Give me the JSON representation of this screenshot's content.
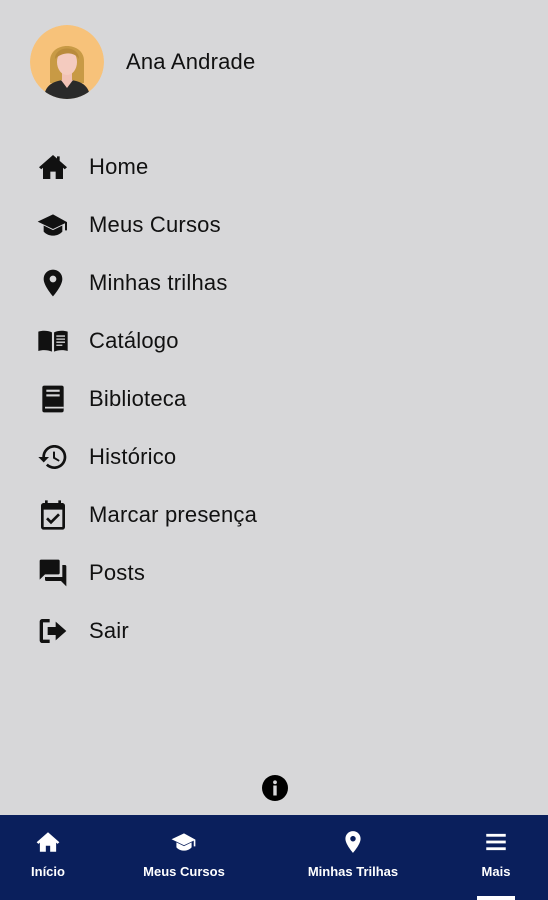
{
  "profile": {
    "name": "Ana Andrade",
    "avatar_icon": "user-avatar-icon"
  },
  "menu": {
    "items": [
      {
        "label": "Home",
        "icon": "home-icon"
      },
      {
        "label": "Meus Cursos",
        "icon": "graduation-cap-icon"
      },
      {
        "label": "Minhas trilhas",
        "icon": "map-pin-icon"
      },
      {
        "label": "Catálogo",
        "icon": "open-book-icon"
      },
      {
        "label": "Biblioteca",
        "icon": "book-icon"
      },
      {
        "label": "Histórico",
        "icon": "history-icon"
      },
      {
        "label": "Marcar presença",
        "icon": "calendar-check-icon"
      },
      {
        "label": "Posts",
        "icon": "forum-icon"
      },
      {
        "label": "Sair",
        "icon": "logout-icon"
      }
    ]
  },
  "info": {
    "icon": "info-icon"
  },
  "bottom_nav": {
    "active": "Mais",
    "items": [
      {
        "label": "Início",
        "icon": "home-icon"
      },
      {
        "label": "Meus Cursos",
        "icon": "graduation-cap-icon"
      },
      {
        "label": "Minhas Trilhas",
        "icon": "map-pin-icon"
      },
      {
        "label": "Mais",
        "icon": "menu-icon"
      }
    ]
  },
  "colors": {
    "background": "#d7d7d9",
    "nav_background": "#0a1f5c",
    "nav_text": "#ffffff",
    "text": "#111111"
  }
}
